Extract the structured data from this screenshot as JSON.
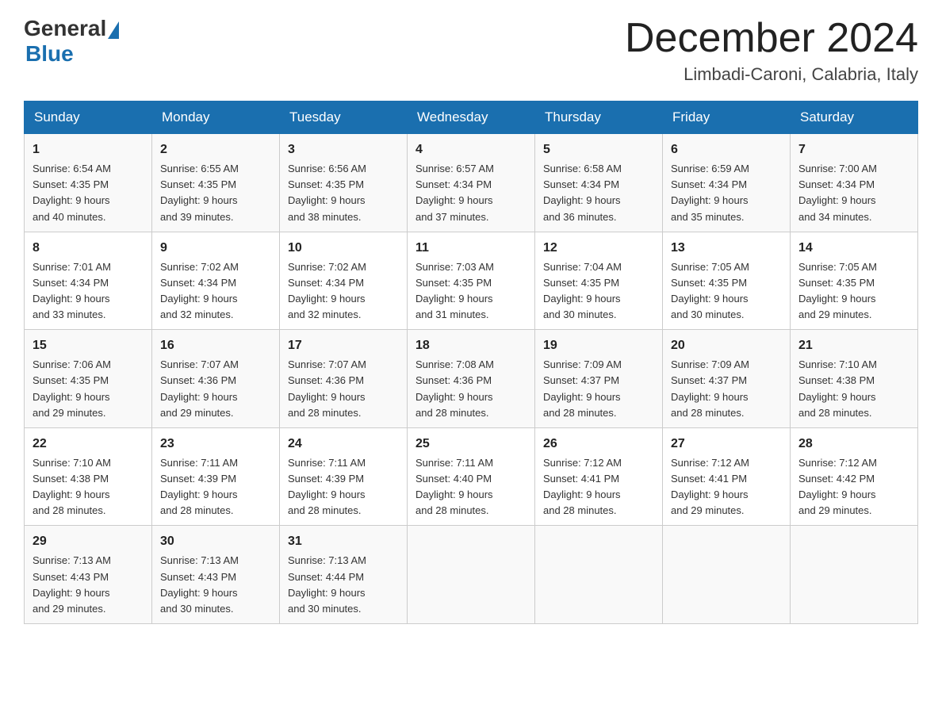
{
  "header": {
    "logo_general": "General",
    "logo_blue": "Blue",
    "month_title": "December 2024",
    "location": "Limbadi-Caroni, Calabria, Italy"
  },
  "days_of_week": [
    "Sunday",
    "Monday",
    "Tuesday",
    "Wednesday",
    "Thursday",
    "Friday",
    "Saturday"
  ],
  "weeks": [
    [
      {
        "day": "1",
        "sunrise": "6:54 AM",
        "sunset": "4:35 PM",
        "daylight": "9 hours and 40 minutes."
      },
      {
        "day": "2",
        "sunrise": "6:55 AM",
        "sunset": "4:35 PM",
        "daylight": "9 hours and 39 minutes."
      },
      {
        "day": "3",
        "sunrise": "6:56 AM",
        "sunset": "4:35 PM",
        "daylight": "9 hours and 38 minutes."
      },
      {
        "day": "4",
        "sunrise": "6:57 AM",
        "sunset": "4:34 PM",
        "daylight": "9 hours and 37 minutes."
      },
      {
        "day": "5",
        "sunrise": "6:58 AM",
        "sunset": "4:34 PM",
        "daylight": "9 hours and 36 minutes."
      },
      {
        "day": "6",
        "sunrise": "6:59 AM",
        "sunset": "4:34 PM",
        "daylight": "9 hours and 35 minutes."
      },
      {
        "day": "7",
        "sunrise": "7:00 AM",
        "sunset": "4:34 PM",
        "daylight": "9 hours and 34 minutes."
      }
    ],
    [
      {
        "day": "8",
        "sunrise": "7:01 AM",
        "sunset": "4:34 PM",
        "daylight": "9 hours and 33 minutes."
      },
      {
        "day": "9",
        "sunrise": "7:02 AM",
        "sunset": "4:34 PM",
        "daylight": "9 hours and 32 minutes."
      },
      {
        "day": "10",
        "sunrise": "7:02 AM",
        "sunset": "4:34 PM",
        "daylight": "9 hours and 32 minutes."
      },
      {
        "day": "11",
        "sunrise": "7:03 AM",
        "sunset": "4:35 PM",
        "daylight": "9 hours and 31 minutes."
      },
      {
        "day": "12",
        "sunrise": "7:04 AM",
        "sunset": "4:35 PM",
        "daylight": "9 hours and 30 minutes."
      },
      {
        "day": "13",
        "sunrise": "7:05 AM",
        "sunset": "4:35 PM",
        "daylight": "9 hours and 30 minutes."
      },
      {
        "day": "14",
        "sunrise": "7:05 AM",
        "sunset": "4:35 PM",
        "daylight": "9 hours and 29 minutes."
      }
    ],
    [
      {
        "day": "15",
        "sunrise": "7:06 AM",
        "sunset": "4:35 PM",
        "daylight": "9 hours and 29 minutes."
      },
      {
        "day": "16",
        "sunrise": "7:07 AM",
        "sunset": "4:36 PM",
        "daylight": "9 hours and 29 minutes."
      },
      {
        "day": "17",
        "sunrise": "7:07 AM",
        "sunset": "4:36 PM",
        "daylight": "9 hours and 28 minutes."
      },
      {
        "day": "18",
        "sunrise": "7:08 AM",
        "sunset": "4:36 PM",
        "daylight": "9 hours and 28 minutes."
      },
      {
        "day": "19",
        "sunrise": "7:09 AM",
        "sunset": "4:37 PM",
        "daylight": "9 hours and 28 minutes."
      },
      {
        "day": "20",
        "sunrise": "7:09 AM",
        "sunset": "4:37 PM",
        "daylight": "9 hours and 28 minutes."
      },
      {
        "day": "21",
        "sunrise": "7:10 AM",
        "sunset": "4:38 PM",
        "daylight": "9 hours and 28 minutes."
      }
    ],
    [
      {
        "day": "22",
        "sunrise": "7:10 AM",
        "sunset": "4:38 PM",
        "daylight": "9 hours and 28 minutes."
      },
      {
        "day": "23",
        "sunrise": "7:11 AM",
        "sunset": "4:39 PM",
        "daylight": "9 hours and 28 minutes."
      },
      {
        "day": "24",
        "sunrise": "7:11 AM",
        "sunset": "4:39 PM",
        "daylight": "9 hours and 28 minutes."
      },
      {
        "day": "25",
        "sunrise": "7:11 AM",
        "sunset": "4:40 PM",
        "daylight": "9 hours and 28 minutes."
      },
      {
        "day": "26",
        "sunrise": "7:12 AM",
        "sunset": "4:41 PM",
        "daylight": "9 hours and 28 minutes."
      },
      {
        "day": "27",
        "sunrise": "7:12 AM",
        "sunset": "4:41 PM",
        "daylight": "9 hours and 29 minutes."
      },
      {
        "day": "28",
        "sunrise": "7:12 AM",
        "sunset": "4:42 PM",
        "daylight": "9 hours and 29 minutes."
      }
    ],
    [
      {
        "day": "29",
        "sunrise": "7:13 AM",
        "sunset": "4:43 PM",
        "daylight": "9 hours and 29 minutes."
      },
      {
        "day": "30",
        "sunrise": "7:13 AM",
        "sunset": "4:43 PM",
        "daylight": "9 hours and 30 minutes."
      },
      {
        "day": "31",
        "sunrise": "7:13 AM",
        "sunset": "4:44 PM",
        "daylight": "9 hours and 30 minutes."
      },
      null,
      null,
      null,
      null
    ]
  ],
  "labels": {
    "sunrise": "Sunrise:",
    "sunset": "Sunset:",
    "daylight": "Daylight:"
  }
}
